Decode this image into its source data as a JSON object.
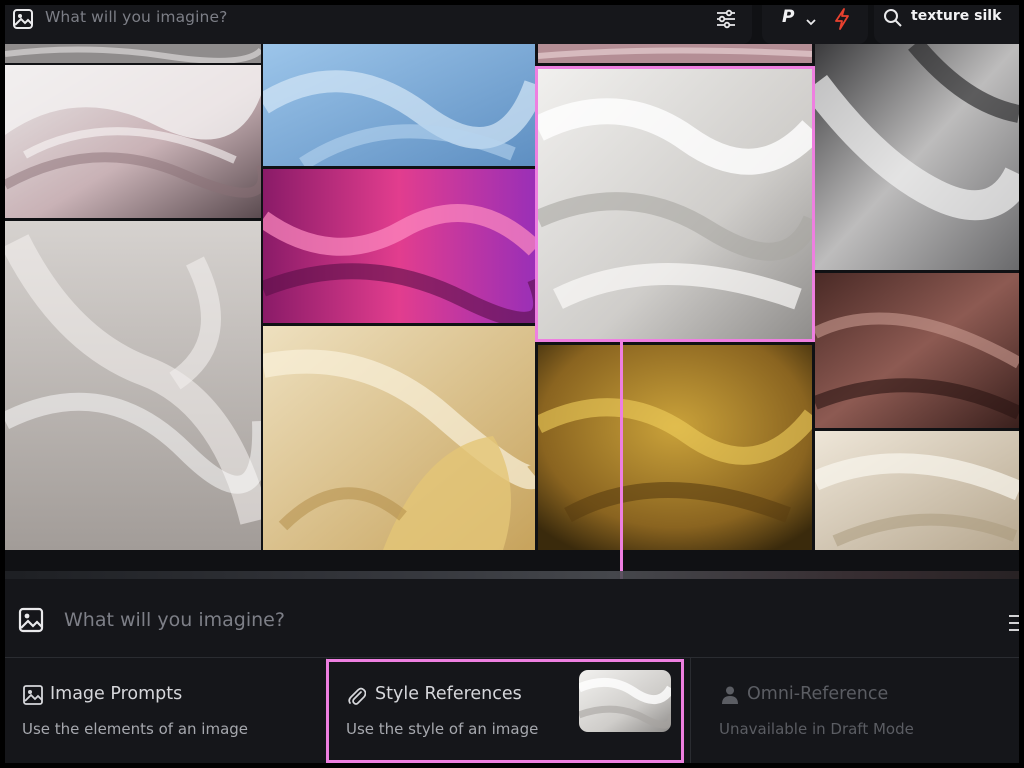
{
  "top_bar": {
    "prompt_placeholder": "What will you imagine?",
    "mode_letter": "P",
    "search_query": "texture silk"
  },
  "gallery": {
    "images": [
      "white-pink-silk-drape",
      "light-blue-silk",
      "magenta-pink-satin",
      "white-satin-folds-selected",
      "grey-ribbed-silk",
      "sheer-white-flowing-silk",
      "cream-yellow-silk",
      "golden-woven-silk",
      "brown-silk-folds",
      "cream-silk-folds"
    ],
    "selected": "white-satin-folds-selected"
  },
  "prompt_bar": {
    "placeholder": "What will you imagine?"
  },
  "options": [
    {
      "title": "Image Prompts",
      "subtitle": "Use the elements of an image",
      "icon": "image-icon",
      "enabled": true
    },
    {
      "title": "Style References",
      "subtitle": "Use the style of an image",
      "icon": "paperclip-icon",
      "enabled": true
    },
    {
      "title": "Omni-Reference",
      "subtitle": "Unavailable in Draft Mode",
      "icon": "person-icon",
      "enabled": false
    }
  ],
  "colors": {
    "highlight": "#ee7fe0",
    "accent_bolt": "#e8412f",
    "panel_bg": "#15161a"
  }
}
